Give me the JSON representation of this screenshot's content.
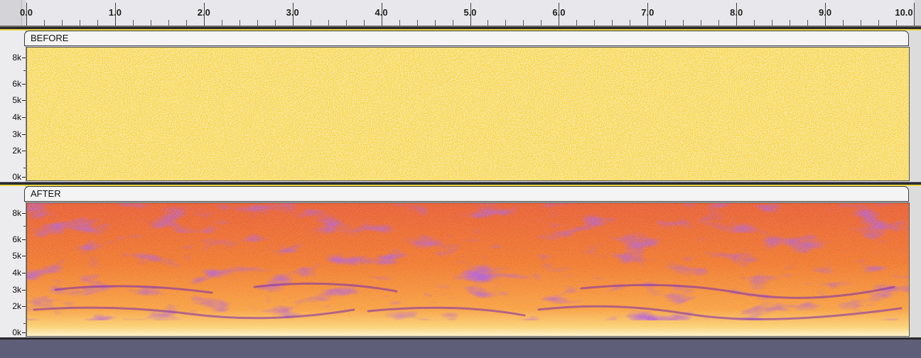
{
  "timeline": {
    "ticks": [
      "0.0",
      "1.0",
      "2.0",
      "3.0",
      "4.0",
      "5.0",
      "6.0",
      "7.0",
      "8.0",
      "9.0",
      "10.0"
    ]
  },
  "tracks": [
    {
      "name": "BEFORE",
      "scale_labels": [
        "8k",
        "6k",
        "5k",
        "4k",
        "3k",
        "2k",
        "0k"
      ],
      "view": "spectrogram-noise"
    },
    {
      "name": "AFTER",
      "scale_labels": [
        "8k",
        "6k",
        "5k",
        "4k",
        "3k",
        "2k",
        "0k"
      ],
      "view": "spectrogram-speech"
    }
  ],
  "colors": {
    "before_base": "#f6dd92",
    "after_base": "#f48a3c",
    "after_dark": "#7a2ab0"
  }
}
